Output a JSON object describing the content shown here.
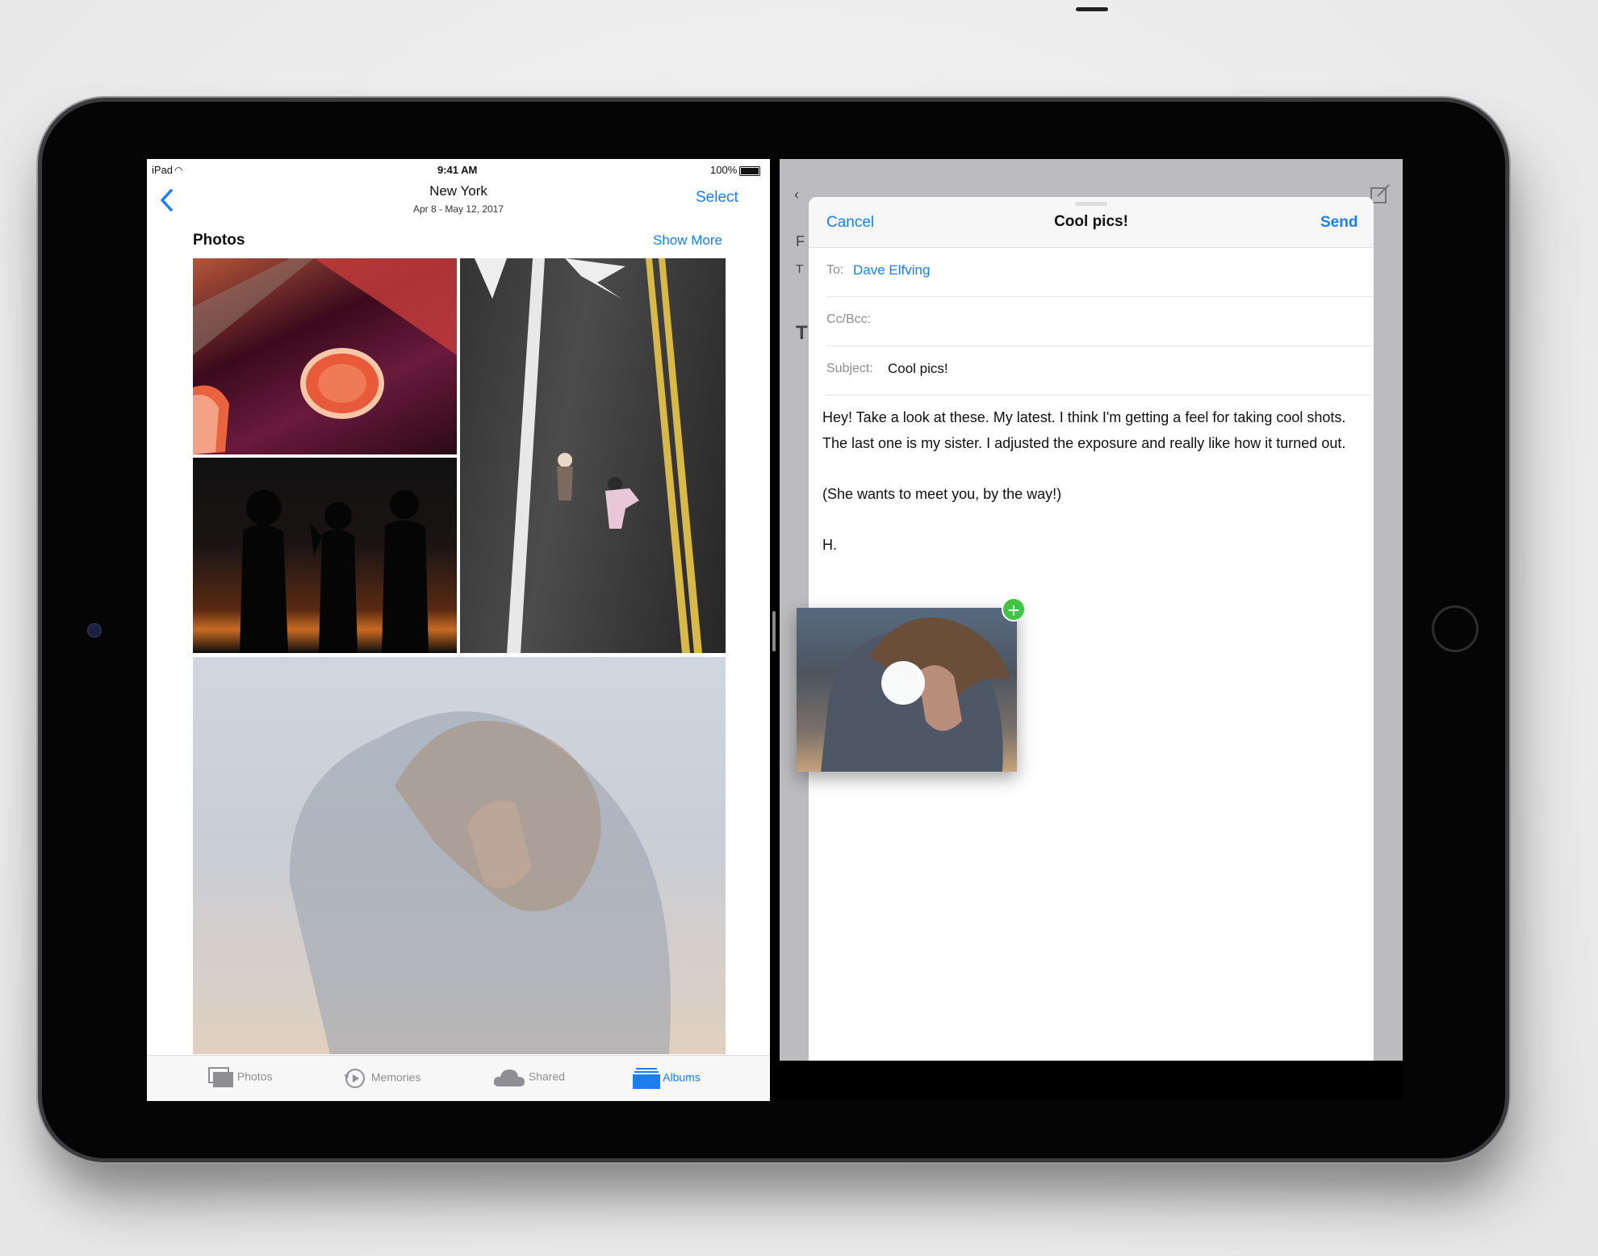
{
  "status_bar": {
    "device": "iPad",
    "time": "9:41 AM",
    "battery": "100%"
  },
  "photos": {
    "nav_title": "New York",
    "nav_subtitle": "Apr 8 - May 12, 2017",
    "select_label": "Select",
    "section_title": "Photos",
    "show_more_label": "Show More",
    "tabs": [
      {
        "label": "Photos",
        "icon": "photos-icon",
        "active": false
      },
      {
        "label": "Memories",
        "icon": "memories-icon",
        "active": false
      },
      {
        "label": "Shared",
        "icon": "cloud-icon",
        "active": false
      },
      {
        "label": "Albums",
        "icon": "albums-icon",
        "active": true
      }
    ]
  },
  "mail": {
    "cancel_label": "Cancel",
    "title": "Cool pics!",
    "send_label": "Send",
    "to_label": "To:",
    "to_value": "Dave Elfving",
    "ccbcc_label": "Cc/Bcc:",
    "subject_label": "Subject:",
    "subject_value": "Cool pics!",
    "body": [
      "Hey! Take a look at these. My latest. I think I'm getting a feel for taking cool shots. The last one is my sister. I adjusted the exposure and really like how it turned out.",
      "(She wants to meet you, by the way!)",
      "H."
    ],
    "add_badge": "+"
  },
  "colors": {
    "accent": "#1b7ef1",
    "add_badge": "#3fc443"
  }
}
